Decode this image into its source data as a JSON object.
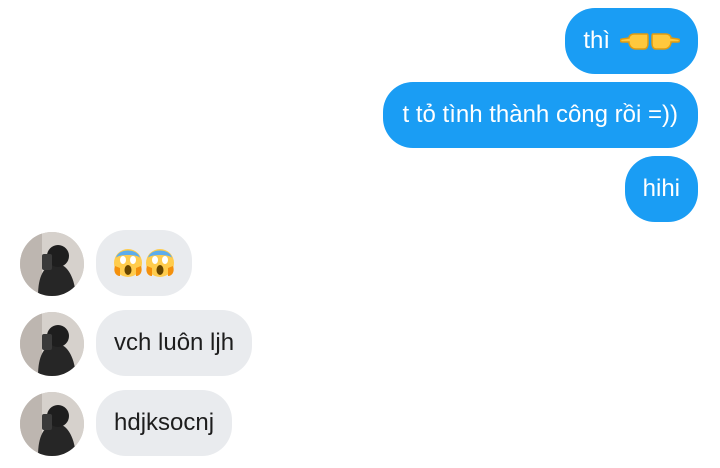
{
  "colors": {
    "sent_bubble": "#1a9df4",
    "received_bubble": "#e9ebee",
    "sent_text": "#ffffff",
    "received_text": "#1d1d1d"
  },
  "messages": [
    {
      "direction": "sent",
      "text": "thì",
      "emoji": "pointing-left-right-hands"
    },
    {
      "direction": "sent",
      "text": "t tỏ tình thành công rồi =))"
    },
    {
      "direction": "sent",
      "text": "hihi"
    },
    {
      "direction": "received",
      "text": "",
      "emoji": "screaming-face x2",
      "avatar": "user-avatar"
    },
    {
      "direction": "received",
      "text": "vch luôn ljh",
      "avatar": "user-avatar"
    },
    {
      "direction": "received",
      "text": "hdjksocnj",
      "avatar": "user-avatar"
    }
  ]
}
